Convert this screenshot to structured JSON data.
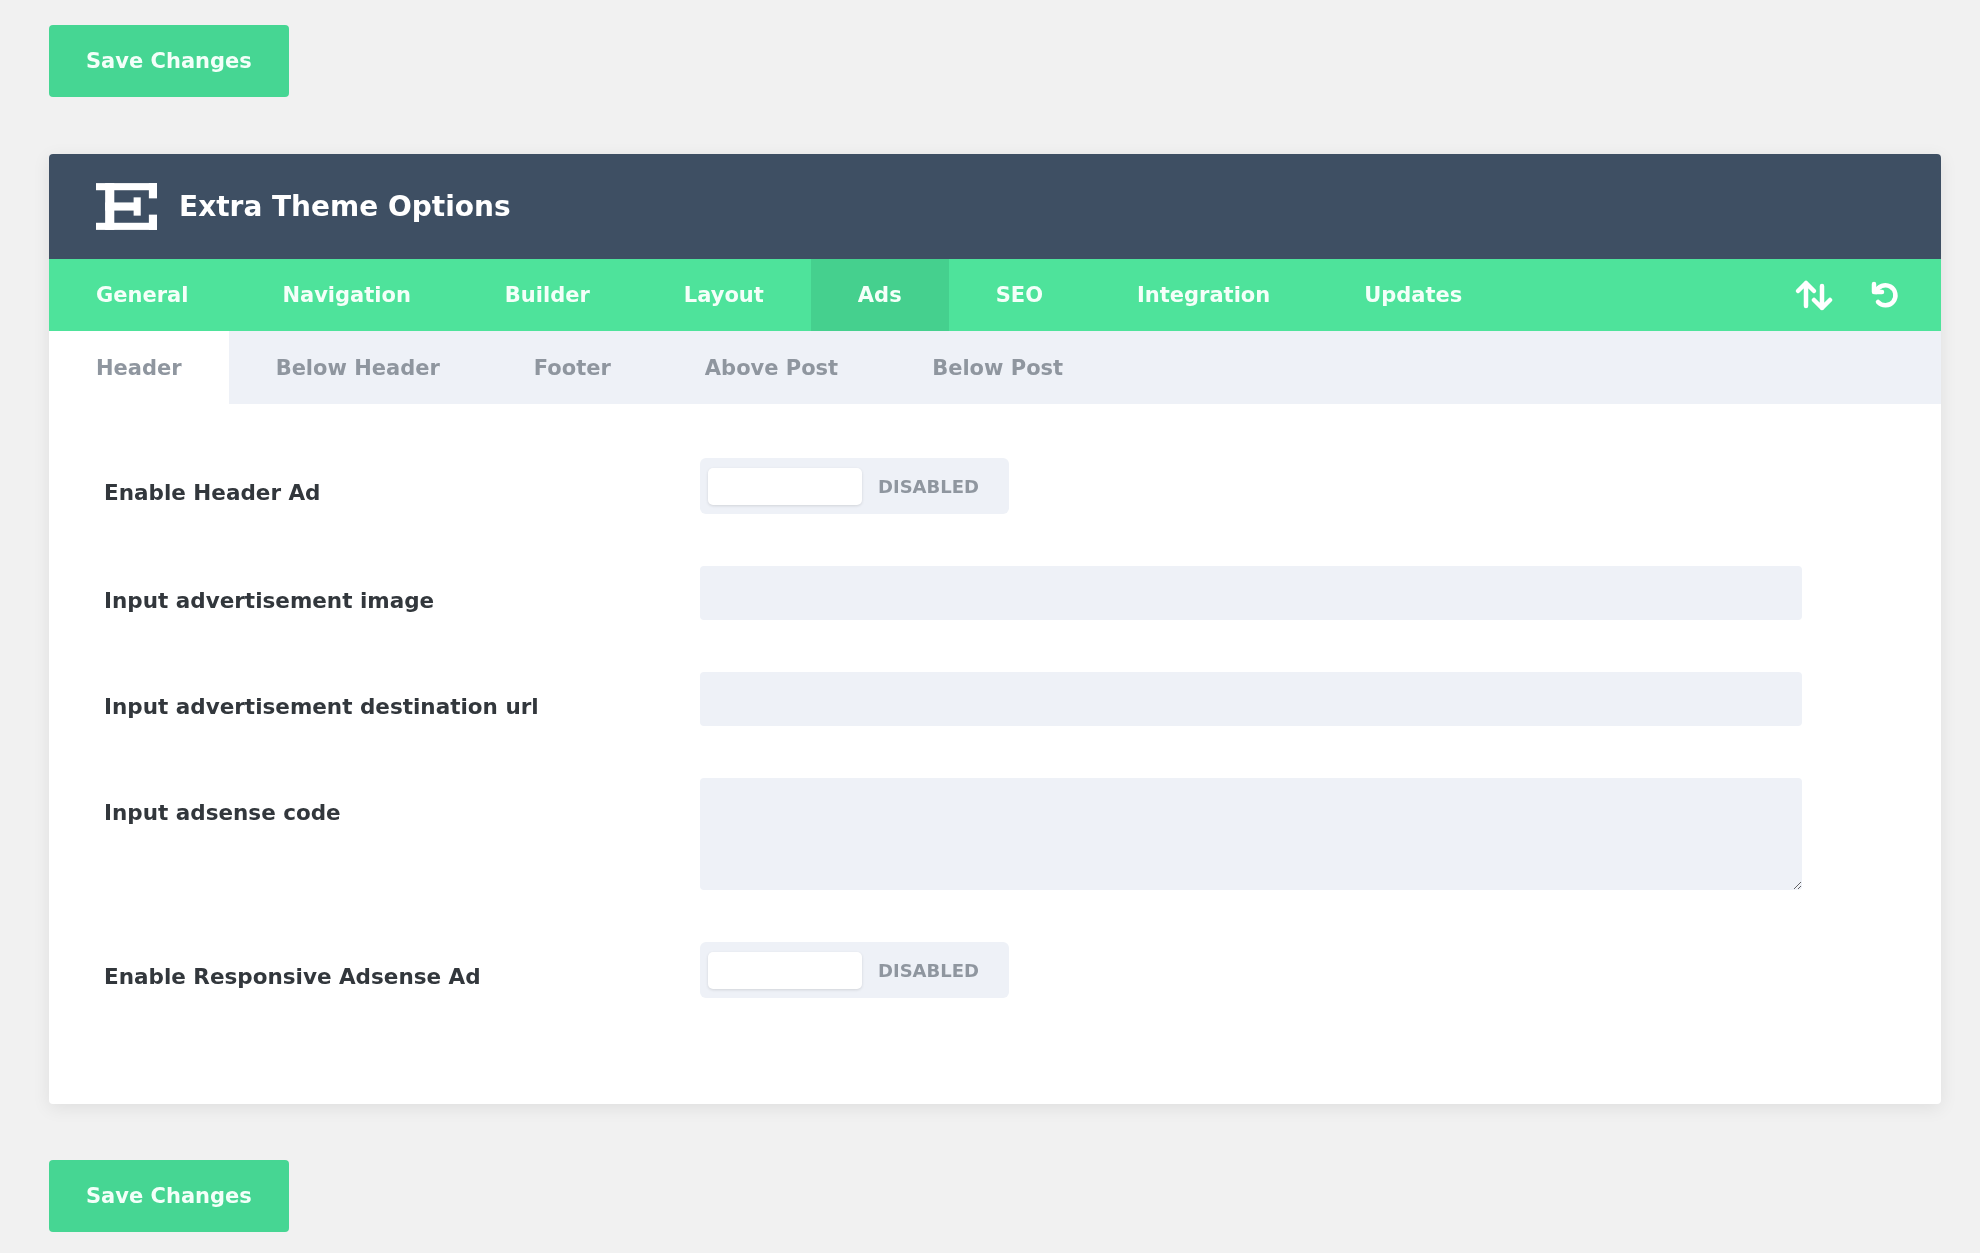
{
  "top_save_button": {
    "label": "Save Changes"
  },
  "panel": {
    "title": "Extra Theme Options",
    "tabs": [
      {
        "label": "General",
        "selected": false
      },
      {
        "label": "Navigation",
        "selected": false
      },
      {
        "label": "Builder",
        "selected": false
      },
      {
        "label": "Layout",
        "selected": false
      },
      {
        "label": "Ads",
        "selected": true
      },
      {
        "label": "SEO",
        "selected": false
      },
      {
        "label": "Integration",
        "selected": false
      },
      {
        "label": "Updates",
        "selected": false
      }
    ],
    "subtabs": [
      {
        "label": "Header",
        "selected": true
      },
      {
        "label": "Below Header",
        "selected": false
      },
      {
        "label": "Footer",
        "selected": false
      },
      {
        "label": "Above Post",
        "selected": false
      },
      {
        "label": "Below Post",
        "selected": false
      }
    ],
    "settings": [
      {
        "kind": "toggle",
        "label": "Enable Header Ad",
        "on": false,
        "status": "DISABLED"
      },
      {
        "kind": "input",
        "label": "Input advertisement image"
      },
      {
        "kind": "input",
        "label": "Input advertisement destination url"
      },
      {
        "kind": "textarea",
        "label": "Input adsense code"
      },
      {
        "kind": "toggle",
        "label": "Enable Responsive Adsense Ad",
        "on": false,
        "status": "DISABLED"
      }
    ]
  },
  "bottom_save_button": {
    "label": "Save Changes"
  }
}
